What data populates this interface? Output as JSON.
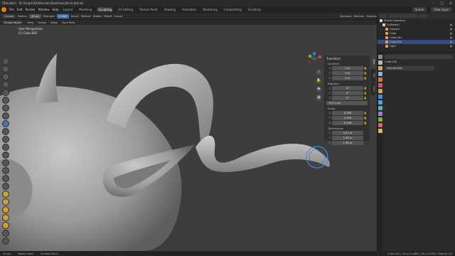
{
  "window": {
    "title": "[Blender] - [E:\\Graph3D\\Blender\\Sketches\\Devil.blend]"
  },
  "menubar": {
    "menus": [
      "File",
      "Edit",
      "Render",
      "Window",
      "Help"
    ],
    "workspaces": [
      "Layout",
      "Modeling",
      "Sculpting",
      "UV Editing",
      "Texture Paint",
      "Shading",
      "Animation",
      "Rendering",
      "Compositing",
      "Scripting"
    ],
    "active_workspace": "Sculpting",
    "scene": "Scene",
    "view_layer": "View Layer"
  },
  "tool_header": {
    "brush": "Crease",
    "radius_label": "Radius",
    "radius_value": "40 px",
    "strength_label": "Strength",
    "strength_value": "0.160",
    "menus": [
      "Brush",
      "Texture",
      "Stroke",
      "Falloff",
      "Cursor"
    ],
    "right_items": [
      "Dyntopo",
      "Remesh",
      "Options"
    ]
  },
  "mode_bar": {
    "mode": "Sculpt Mode",
    "menus": [
      "View",
      "Sculpt",
      "Mask",
      "Face Sets"
    ]
  },
  "viewport_info": {
    "view_name": "User Perspective",
    "object_label": "(1) Cube.002"
  },
  "transform_panel": {
    "title": "Transform",
    "location_label": "Location",
    "location": [
      {
        "axis": "X",
        "value": "0 m"
      },
      {
        "axis": "Y",
        "value": "0 m"
      },
      {
        "axis": "Z",
        "value": "0 m"
      }
    ],
    "rotation_label": "Rotation",
    "rotation": [
      {
        "axis": "X",
        "value": "0°"
      },
      {
        "axis": "Y",
        "value": "0°"
      },
      {
        "axis": "Z",
        "value": "0°"
      }
    ],
    "rotation_mode": "XYZ Euler",
    "scale_label": "Scale",
    "scale": [
      {
        "axis": "X",
        "value": "0.298"
      },
      {
        "axis": "Y",
        "value": "0.298"
      },
      {
        "axis": "Z",
        "value": "0.298"
      }
    ],
    "dimensions_label": "Dimensions",
    "dimensions": [
      {
        "axis": "X",
        "value": "4.22 m"
      },
      {
        "axis": "Y",
        "value": "1.03 m"
      },
      {
        "axis": "Z",
        "value": "1.38 m"
      }
    ],
    "sidebar_tabs": [
      "Item",
      "Tool",
      "View"
    ]
  },
  "outliner": {
    "rows": [
      {
        "label": "Scene Collection",
        "icon_color": "#d8d8d8",
        "selected": false
      },
      {
        "label": "Collection",
        "icon_color": "#d8d8d8",
        "selected": false
      },
      {
        "label": "Camera",
        "icon_color": "#e0a15a",
        "selected": false
      },
      {
        "label": "Cube",
        "icon_color": "#e0a15a",
        "selected": false
      },
      {
        "label": "Cube.001",
        "icon_color": "#e0a15a",
        "selected": false
      },
      {
        "label": "Cube.002",
        "icon_color": "#e0a15a",
        "selected": true
      },
      {
        "label": "Light",
        "icon_color": "#e0a15a",
        "selected": false
      }
    ]
  },
  "properties": {
    "object_name": "Cube.002",
    "modifier_object": "Cube.002",
    "add_modifier": "Add Modifier"
  },
  "statusbar": {
    "left": [
      "Sculpt",
      "Rotate View",
      "Context Menu"
    ],
    "right": "Cube.002 | Verts:14,688 | Tris:29,358 | Objects:1/4"
  },
  "colors": {
    "accent": "#4772b3",
    "viewport_bg": "#3d3d3d",
    "brush_circle": "#3f8fe0"
  }
}
